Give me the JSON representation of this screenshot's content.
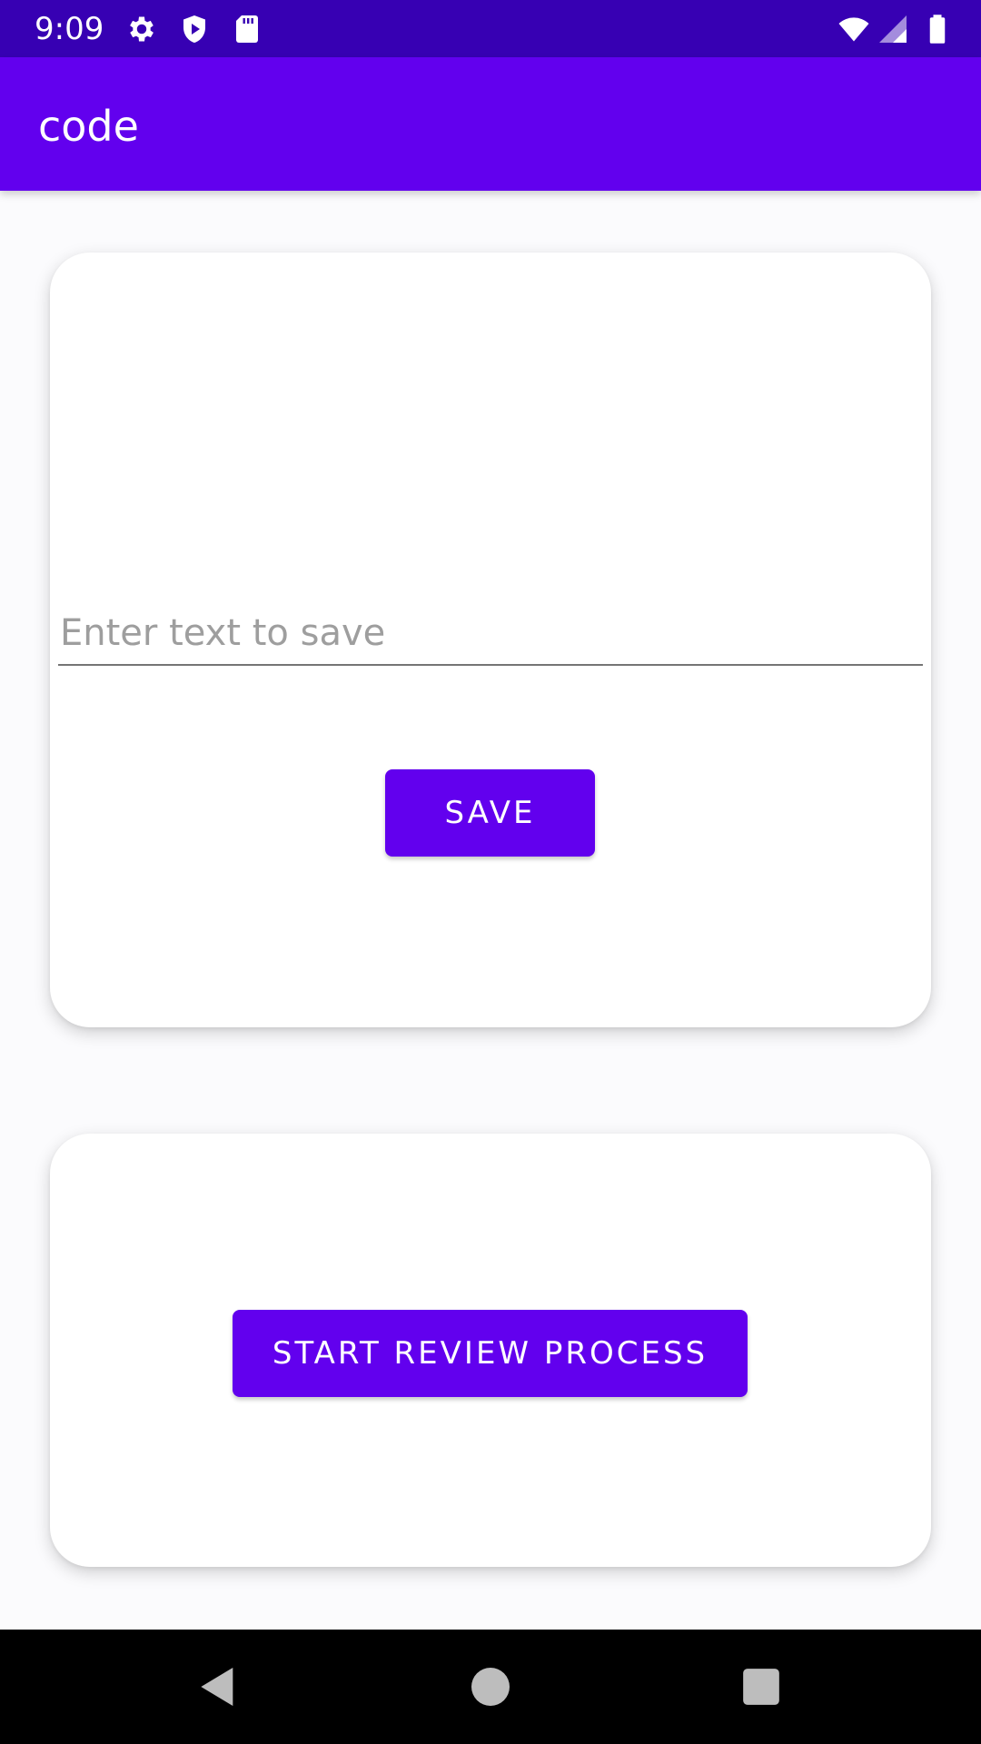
{
  "status_bar": {
    "time": "9:09",
    "icons": [
      "gear-icon",
      "shield-play-icon",
      "sd-card-icon",
      "wifi-icon",
      "signal-icon",
      "battery-icon"
    ]
  },
  "app_bar": {
    "title": "code",
    "color": "#6200ee"
  },
  "save_card": {
    "input_placeholder": "Enter text to save",
    "input_value": "",
    "save_label": "SAVE"
  },
  "review_card": {
    "review_label": "START REVIEW PROCESS"
  },
  "nav_bar": {
    "icons": [
      "back-icon",
      "home-icon",
      "recents-icon"
    ]
  },
  "colors": {
    "status_bar": "#3700b3",
    "accent": "#6200ee",
    "background": "#fbfbfd"
  }
}
